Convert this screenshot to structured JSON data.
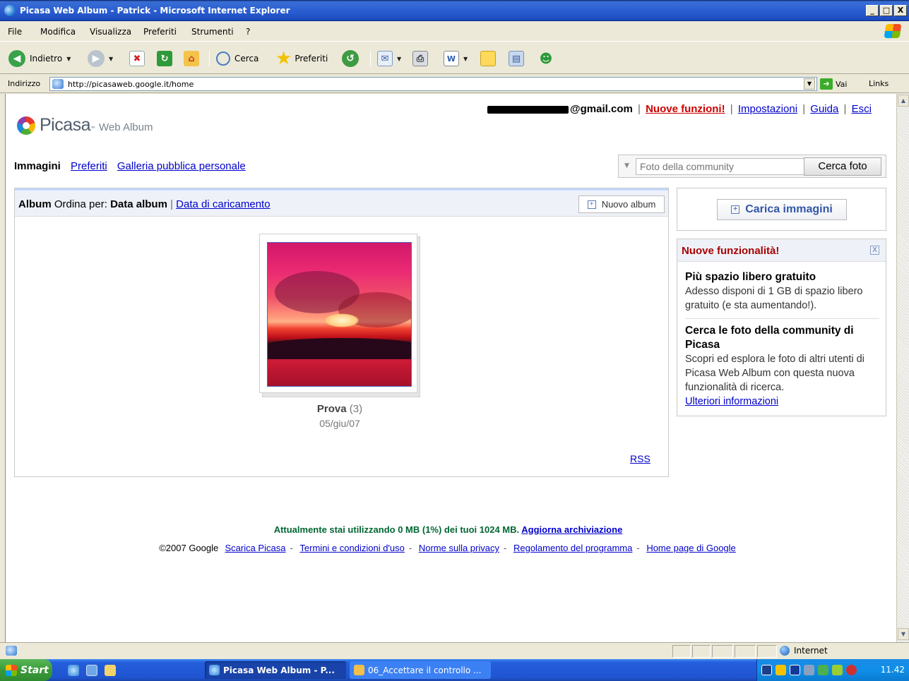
{
  "window": {
    "title": "Picasa Web Album - Patrick - Microsoft Internet Explorer",
    "buttons": [
      "_",
      "□",
      "X"
    ]
  },
  "menu": [
    "File",
    "Modifica",
    "Visualizza",
    "Preferiti",
    "Strumenti",
    "?"
  ],
  "toolbar": {
    "back": "Indietro",
    "search": "Cerca",
    "favorites": "Preferiti"
  },
  "address": {
    "label": "Indirizzo",
    "url": "http://picasaweb.google.it/home",
    "go": "Vai",
    "links": "Links"
  },
  "header": {
    "logo_name": "Picasa",
    "logo_tm": "™",
    "logo_sub": "Web Album",
    "email": "@gmail.com",
    "links": {
      "new_features": "Nuove funzioni!",
      "settings": "Impostazioni",
      "help": "Guida",
      "logout": "Esci"
    },
    "separator": "|"
  },
  "nav": {
    "current": "Immagini",
    "favorites": "Preferiti",
    "gallery": "Galleria pubblica personale"
  },
  "search": {
    "placeholder": "Foto della community",
    "button": "Cerca foto"
  },
  "album_panel": {
    "album_label": "Album",
    "sort_label": "Ordina per:",
    "sort_current": "Data album",
    "sort_separator": "|",
    "sort_other": "Data di caricamento",
    "new_album": "Nuovo album",
    "albums": [
      {
        "title": "Prova",
        "count": "(3)",
        "date": "05/giu/07"
      }
    ],
    "rss": "RSS"
  },
  "upload": {
    "label": "Carica immagini"
  },
  "news": {
    "title": "Nuove funzionalità!",
    "close": "X",
    "items": [
      {
        "heading": "Più spazio libero gratuito",
        "text": "Adesso disponi di 1 GB di spazio libero gratuito (e sta aumentando!)."
      },
      {
        "heading": "Cerca le foto della community di Picasa",
        "text": "Scopri ed esplora le foto di altri utenti di Picasa Web Album con questa nuova funzionalità di ricerca.",
        "link": "Ulteriori informazioni"
      }
    ]
  },
  "usage": {
    "text": "Attualmente stai utilizzando 0 MB (1%) dei tuoi 1024 MB.",
    "link": "Aggiorna archiviazione"
  },
  "footer": {
    "copyright": "©2007 Google",
    "links": [
      "Scarica Picasa",
      "Termini e condizioni d'uso",
      "Norme sulla privacy",
      "Regolamento del programma",
      "Home page di Google"
    ],
    "sep": "-"
  },
  "statusbar": {
    "zone": "Internet"
  },
  "taskbar": {
    "start": "Start",
    "tasks": [
      "Picasa Web Album - P...",
      "06_Accettare il controllo ..."
    ],
    "clock": "11.42"
  }
}
